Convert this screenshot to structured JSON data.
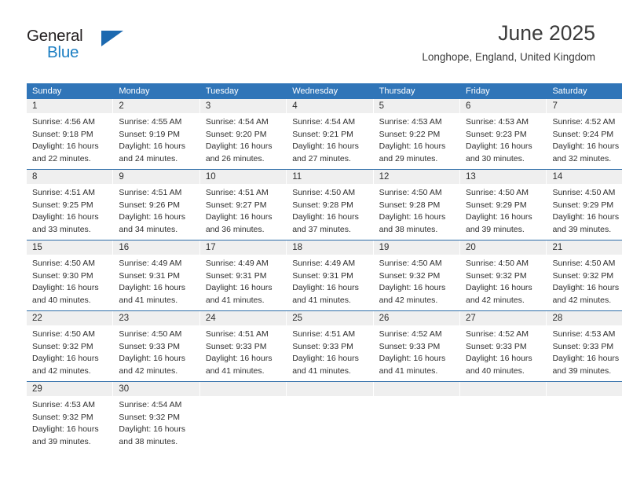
{
  "logo": {
    "text_top": "General",
    "text_bottom": "Blue",
    "icon": "triangle-mark",
    "color_primary": "#1c69b0",
    "color_text": "#231f20"
  },
  "header": {
    "title": "June 2025",
    "subtitle": "Longhope, England, United Kingdom"
  },
  "theme": {
    "header_bg": "#3075b8",
    "daynum_bg": "#efefef",
    "row_rule": "#2e6da8"
  },
  "calendar": {
    "weekday_headers": [
      "Sunday",
      "Monday",
      "Tuesday",
      "Wednesday",
      "Thursday",
      "Friday",
      "Saturday"
    ],
    "weeks": [
      [
        {
          "day": "1",
          "lines": [
            "Sunrise: 4:56 AM",
            "Sunset: 9:18 PM",
            "Daylight: 16 hours",
            "and 22 minutes."
          ]
        },
        {
          "day": "2",
          "lines": [
            "Sunrise: 4:55 AM",
            "Sunset: 9:19 PM",
            "Daylight: 16 hours",
            "and 24 minutes."
          ]
        },
        {
          "day": "3",
          "lines": [
            "Sunrise: 4:54 AM",
            "Sunset: 9:20 PM",
            "Daylight: 16 hours",
            "and 26 minutes."
          ]
        },
        {
          "day": "4",
          "lines": [
            "Sunrise: 4:54 AM",
            "Sunset: 9:21 PM",
            "Daylight: 16 hours",
            "and 27 minutes."
          ]
        },
        {
          "day": "5",
          "lines": [
            "Sunrise: 4:53 AM",
            "Sunset: 9:22 PM",
            "Daylight: 16 hours",
            "and 29 minutes."
          ]
        },
        {
          "day": "6",
          "lines": [
            "Sunrise: 4:53 AM",
            "Sunset: 9:23 PM",
            "Daylight: 16 hours",
            "and 30 minutes."
          ]
        },
        {
          "day": "7",
          "lines": [
            "Sunrise: 4:52 AM",
            "Sunset: 9:24 PM",
            "Daylight: 16 hours",
            "and 32 minutes."
          ]
        }
      ],
      [
        {
          "day": "8",
          "lines": [
            "Sunrise: 4:51 AM",
            "Sunset: 9:25 PM",
            "Daylight: 16 hours",
            "and 33 minutes."
          ]
        },
        {
          "day": "9",
          "lines": [
            "Sunrise: 4:51 AM",
            "Sunset: 9:26 PM",
            "Daylight: 16 hours",
            "and 34 minutes."
          ]
        },
        {
          "day": "10",
          "lines": [
            "Sunrise: 4:51 AM",
            "Sunset: 9:27 PM",
            "Daylight: 16 hours",
            "and 36 minutes."
          ]
        },
        {
          "day": "11",
          "lines": [
            "Sunrise: 4:50 AM",
            "Sunset: 9:28 PM",
            "Daylight: 16 hours",
            "and 37 minutes."
          ]
        },
        {
          "day": "12",
          "lines": [
            "Sunrise: 4:50 AM",
            "Sunset: 9:28 PM",
            "Daylight: 16 hours",
            "and 38 minutes."
          ]
        },
        {
          "day": "13",
          "lines": [
            "Sunrise: 4:50 AM",
            "Sunset: 9:29 PM",
            "Daylight: 16 hours",
            "and 39 minutes."
          ]
        },
        {
          "day": "14",
          "lines": [
            "Sunrise: 4:50 AM",
            "Sunset: 9:29 PM",
            "Daylight: 16 hours",
            "and 39 minutes."
          ]
        }
      ],
      [
        {
          "day": "15",
          "lines": [
            "Sunrise: 4:50 AM",
            "Sunset: 9:30 PM",
            "Daylight: 16 hours",
            "and 40 minutes."
          ]
        },
        {
          "day": "16",
          "lines": [
            "Sunrise: 4:49 AM",
            "Sunset: 9:31 PM",
            "Daylight: 16 hours",
            "and 41 minutes."
          ]
        },
        {
          "day": "17",
          "lines": [
            "Sunrise: 4:49 AM",
            "Sunset: 9:31 PM",
            "Daylight: 16 hours",
            "and 41 minutes."
          ]
        },
        {
          "day": "18",
          "lines": [
            "Sunrise: 4:49 AM",
            "Sunset: 9:31 PM",
            "Daylight: 16 hours",
            "and 41 minutes."
          ]
        },
        {
          "day": "19",
          "lines": [
            "Sunrise: 4:50 AM",
            "Sunset: 9:32 PM",
            "Daylight: 16 hours",
            "and 42 minutes."
          ]
        },
        {
          "day": "20",
          "lines": [
            "Sunrise: 4:50 AM",
            "Sunset: 9:32 PM",
            "Daylight: 16 hours",
            "and 42 minutes."
          ]
        },
        {
          "day": "21",
          "lines": [
            "Sunrise: 4:50 AM",
            "Sunset: 9:32 PM",
            "Daylight: 16 hours",
            "and 42 minutes."
          ]
        }
      ],
      [
        {
          "day": "22",
          "lines": [
            "Sunrise: 4:50 AM",
            "Sunset: 9:32 PM",
            "Daylight: 16 hours",
            "and 42 minutes."
          ]
        },
        {
          "day": "23",
          "lines": [
            "Sunrise: 4:50 AM",
            "Sunset: 9:33 PM",
            "Daylight: 16 hours",
            "and 42 minutes."
          ]
        },
        {
          "day": "24",
          "lines": [
            "Sunrise: 4:51 AM",
            "Sunset: 9:33 PM",
            "Daylight: 16 hours",
            "and 41 minutes."
          ]
        },
        {
          "day": "25",
          "lines": [
            "Sunrise: 4:51 AM",
            "Sunset: 9:33 PM",
            "Daylight: 16 hours",
            "and 41 minutes."
          ]
        },
        {
          "day": "26",
          "lines": [
            "Sunrise: 4:52 AM",
            "Sunset: 9:33 PM",
            "Daylight: 16 hours",
            "and 41 minutes."
          ]
        },
        {
          "day": "27",
          "lines": [
            "Sunrise: 4:52 AM",
            "Sunset: 9:33 PM",
            "Daylight: 16 hours",
            "and 40 minutes."
          ]
        },
        {
          "day": "28",
          "lines": [
            "Sunrise: 4:53 AM",
            "Sunset: 9:33 PM",
            "Daylight: 16 hours",
            "and 39 minutes."
          ]
        }
      ],
      [
        {
          "day": "29",
          "lines": [
            "Sunrise: 4:53 AM",
            "Sunset: 9:32 PM",
            "Daylight: 16 hours",
            "and 39 minutes."
          ]
        },
        {
          "day": "30",
          "lines": [
            "Sunrise: 4:54 AM",
            "Sunset: 9:32 PM",
            "Daylight: 16 hours",
            "and 38 minutes."
          ]
        },
        {
          "day": "",
          "lines": []
        },
        {
          "day": "",
          "lines": []
        },
        {
          "day": "",
          "lines": []
        },
        {
          "day": "",
          "lines": []
        },
        {
          "day": "",
          "lines": []
        }
      ]
    ]
  }
}
